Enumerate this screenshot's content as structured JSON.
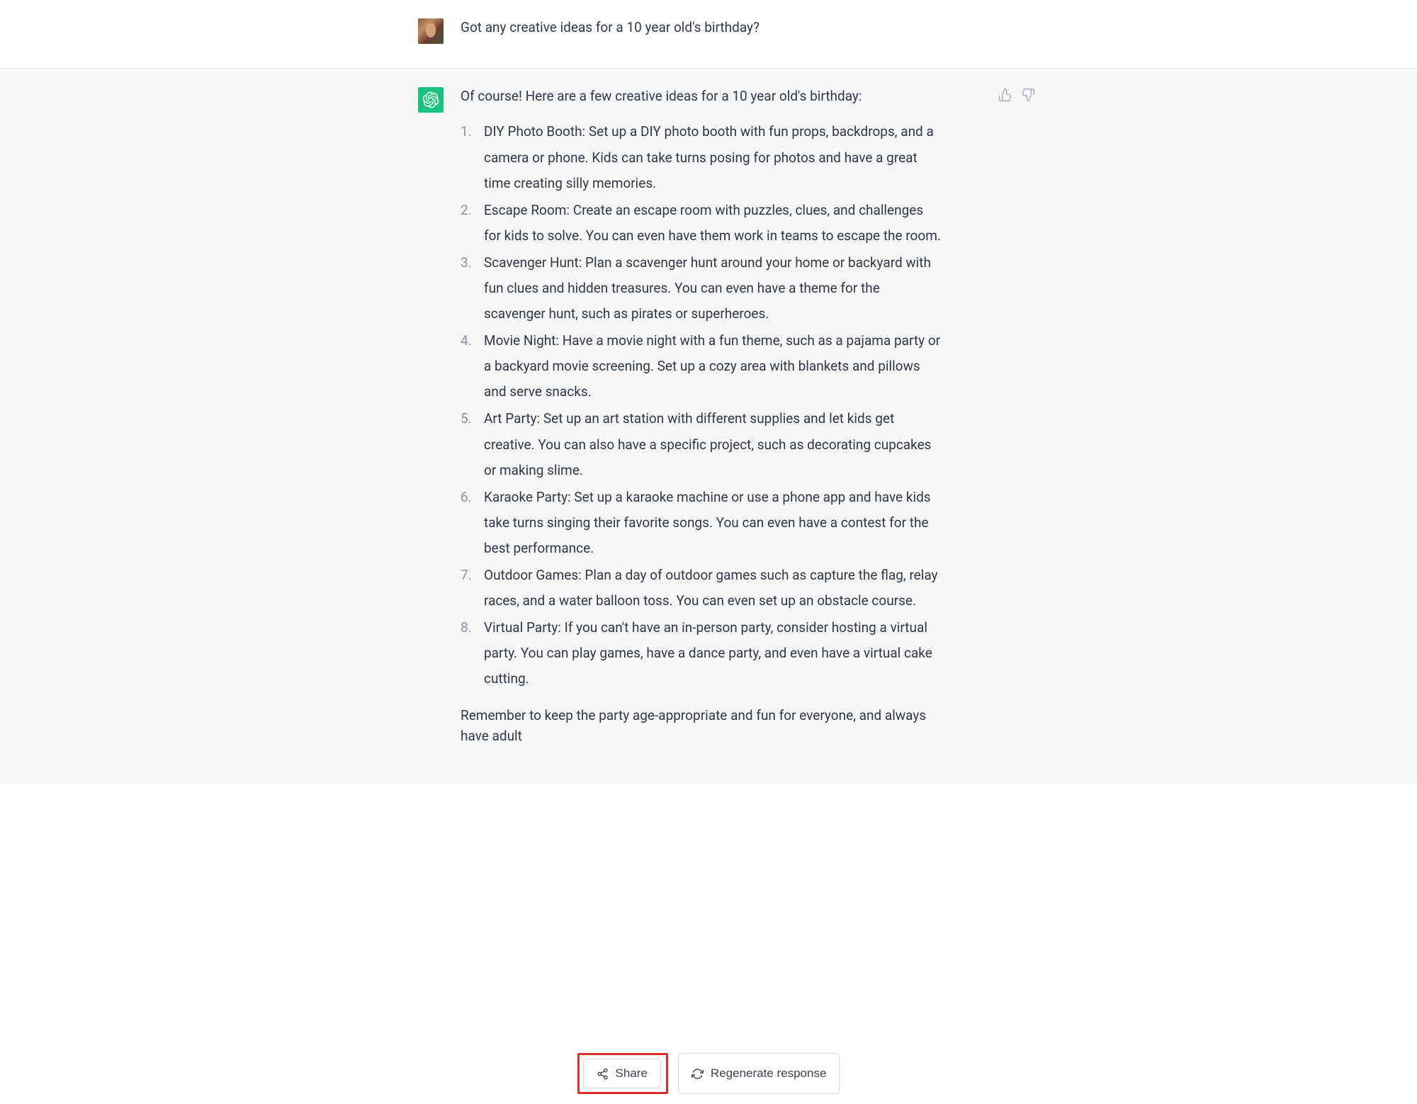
{
  "user_message": "Got any creative ideas for a 10 year old's birthday?",
  "assistant_intro": "Of course! Here are a few creative ideas for a 10 year old's birthday:",
  "ideas": [
    "DIY Photo Booth: Set up a DIY photo booth with fun props, backdrops, and a camera or phone. Kids can take turns posing for photos and have a great time creating silly memories.",
    "Escape Room: Create an escape room with puzzles, clues, and challenges for kids to solve. You can even have them work in teams to escape the room.",
    "Scavenger Hunt: Plan a scavenger hunt around your home or backyard with fun clues and hidden treasures. You can even have a theme for the scavenger hunt, such as pirates or superheroes.",
    "Movie Night: Have a movie night with a fun theme, such as a pajama party or a backyard movie screening. Set up a cozy area with blankets and pillows and serve snacks.",
    "Art Party: Set up an art station with different supplies and let kids get creative. You can also have a specific project, such as decorating cupcakes or making slime.",
    "Karaoke Party: Set up a karaoke machine or use a phone app and have kids take turns singing their favorite songs. You can even have a contest for the best performance.",
    "Outdoor Games: Plan a day of outdoor games such as capture the flag, relay races, and a water balloon toss. You can even set up an obstacle course.",
    "Virtual Party: If you can't have an in-person party, consider hosting a virtual party. You can play games, have a dance party, and even have a virtual cake cutting."
  ],
  "assistant_outro": "Remember to keep the party age-appropriate and fun for everyone, and always have adult",
  "buttons": {
    "share": "Share",
    "regenerate": "Regenerate response"
  }
}
